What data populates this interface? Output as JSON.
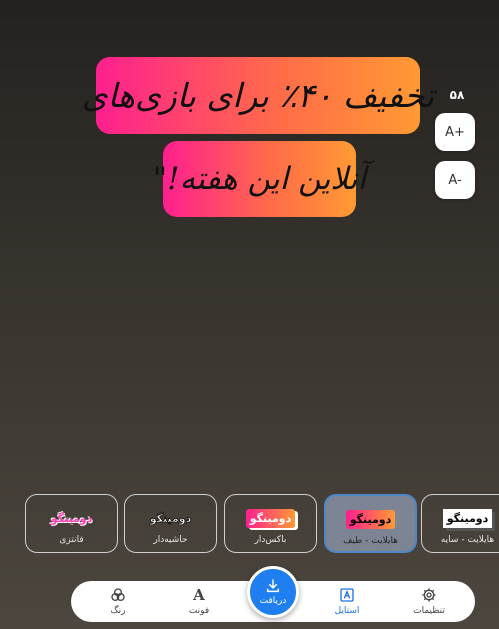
{
  "caption": {
    "line1": "تخفیف ۴۰٪ برای بازی‌های",
    "line2": "آنلاین این هفته!\""
  },
  "font_size": {
    "value": "۵۸",
    "increase_label": "A+",
    "decrease_label": "A-"
  },
  "styles": [
    {
      "preview": "دومینگو",
      "label": "هایلایت - سایه"
    },
    {
      "preview": "دومینگو",
      "label": "هایلایت - طیف"
    },
    {
      "preview": "دومینگو",
      "label": "باکس‌دار"
    },
    {
      "preview": "دومینگو",
      "label": "حاشیه‌دار"
    },
    {
      "preview": "دومینگو",
      "label": "فانتزی"
    }
  ],
  "selected_style": "هایلایت - طیف",
  "nav": {
    "settings": "تنظیمات",
    "style": "استایل",
    "download": "دریافت",
    "font": "فونت",
    "color": "رنگ"
  },
  "colors": {
    "accent": "#1f7ef0",
    "highlight_start": "#ff1f8f",
    "highlight_end": "#ff9a33",
    "selected_card": "#7d8595"
  },
  "icons": {
    "settings": "gear-icon",
    "style": "style-icon",
    "download": "download-icon",
    "font": "font-icon",
    "color": "color-circles-icon"
  }
}
